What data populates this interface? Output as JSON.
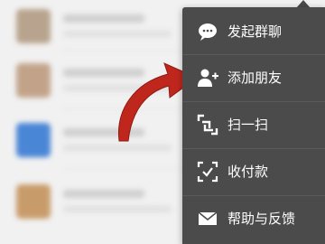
{
  "menu": {
    "items": [
      {
        "label": "发起群聊",
        "icon": "chat-bubble-icon"
      },
      {
        "label": "添加朋友",
        "icon": "add-contact-icon"
      },
      {
        "label": "扫一扫",
        "icon": "scan-icon"
      },
      {
        "label": "收付款",
        "icon": "payment-icon"
      },
      {
        "label": "帮助与反馈",
        "icon": "mail-icon"
      }
    ]
  },
  "colors": {
    "menu_background": "#4b4b4b",
    "arrow": "#c0271c",
    "menu_text": "#ffffff"
  }
}
